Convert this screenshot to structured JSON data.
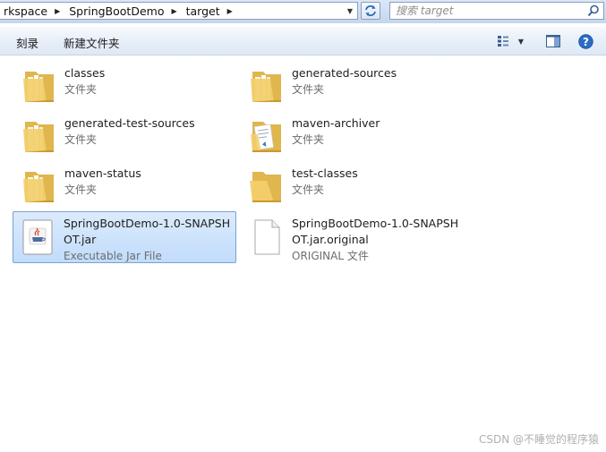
{
  "address_bar": {
    "crumbs": [
      "rkspace",
      "SpringBootDemo",
      "target"
    ]
  },
  "search": {
    "placeholder": "搜索 target"
  },
  "toolbar": {
    "burn_label": "刻录",
    "new_folder_label": "新建文件夹"
  },
  "icons": {
    "back": "chevron-right-icon",
    "refresh": "refresh-icon",
    "search": "search-icon",
    "views": "views-icon",
    "preview_pane": "preview-pane-icon",
    "help": "help-icon",
    "folder": "folder-icon",
    "jar": "java-jar-icon",
    "file": "blank-file-icon"
  },
  "colors": {
    "selection": "#c1dcfc",
    "selection_border": "#7da2ce",
    "folder": "#f2cf6c",
    "help": "#2b6cc4"
  },
  "files": [
    {
      "name": "classes",
      "type": "文件夹",
      "kind": "folder",
      "selected": false
    },
    {
      "name": "generated-sources",
      "type": "文件夹",
      "kind": "folder",
      "selected": false
    },
    {
      "name": "generated-test-sources",
      "type": "文件夹",
      "kind": "folder",
      "selected": false
    },
    {
      "name": "maven-archiver",
      "type": "文件夹",
      "kind": "folder-doc",
      "selected": false
    },
    {
      "name": "maven-status",
      "type": "文件夹",
      "kind": "folder",
      "selected": false
    },
    {
      "name": "test-classes",
      "type": "文件夹",
      "kind": "folder-empty",
      "selected": false
    },
    {
      "name": "SpringBootDemo-1.0-SNAPSHOT.jar",
      "type": "Executable Jar File",
      "kind": "jar",
      "selected": true
    },
    {
      "name": "SpringBootDemo-1.0-SNAPSHOT.jar.original",
      "type": "ORIGINAL 文件",
      "kind": "file",
      "selected": false
    }
  ],
  "watermark": "CSDN @不睡觉的程序猿"
}
